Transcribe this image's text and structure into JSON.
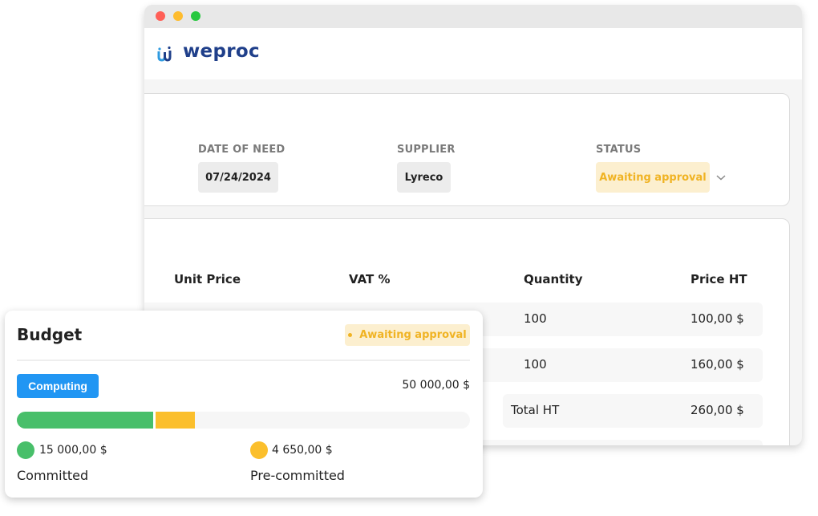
{
  "window": {
    "controls": [
      "close",
      "minimize",
      "maximize"
    ],
    "colors": {
      "close": "#ff5f57",
      "minimize": "#febc2e",
      "maximize": "#28c840"
    }
  },
  "brand": {
    "name": "weproc",
    "icon": "weproc-logo-icon",
    "color": "#1f3f8a",
    "icon_colors": [
      "#2f9be0",
      "#1f3f8a"
    ]
  },
  "order": {
    "fields": [
      {
        "label": "DATE OF NEED",
        "value": "07/24/2024"
      },
      {
        "label": "SUPPLIER",
        "value": "Lyreco"
      },
      {
        "label": "STATUS",
        "value": "Awaiting approval"
      }
    ],
    "status_colors": {
      "bg": "#fcefcf",
      "fg": "#f0b323"
    }
  },
  "table": {
    "columns": [
      "Unit Price",
      "VAT %",
      "Quantity",
      "Price HT"
    ],
    "rows": [
      {
        "quantity": "100",
        "price_ht": "100,00 $"
      },
      {
        "quantity": "100",
        "price_ht": "160,00 $"
      }
    ],
    "total": {
      "label": "Total HT",
      "value": "260,00 $"
    }
  },
  "budget": {
    "title": "Budget",
    "status": "Awaiting approval",
    "category": "Computing",
    "category_color": "#2196f3",
    "total": "50 000,00 $",
    "total_amount": 50000,
    "committed": {
      "label": "Committed",
      "value": "15 000,00 $",
      "amount": 15000,
      "color": "#48bf6a"
    },
    "precommitted": {
      "label": "Pre-committed",
      "value": "4 650,00 $",
      "amount": 4650,
      "color": "#fbbf2c"
    }
  }
}
